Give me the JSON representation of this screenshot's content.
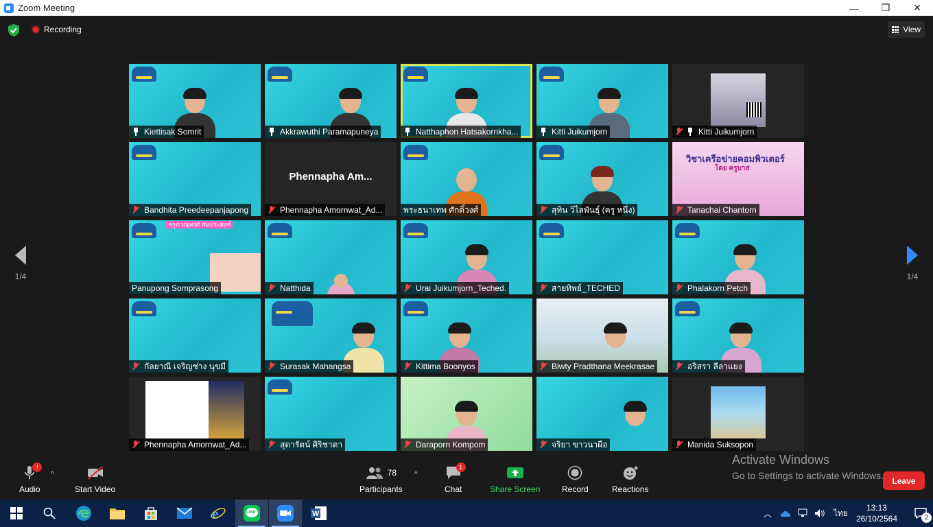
{
  "window": {
    "title": "Zoom Meeting",
    "controls": [
      "—",
      "❐",
      "✕"
    ]
  },
  "topbar": {
    "recording_label": "Recording",
    "view_label": "View"
  },
  "pager": {
    "left_text": "1/4",
    "right_text": "1/4"
  },
  "participants": [
    {
      "name": "Kiettisak Somrit",
      "status": "pin"
    },
    {
      "name": "Akkrawuthi Paramapuneya",
      "status": "pin"
    },
    {
      "name": "Natthaphon Hatsakornkha...",
      "status": "pin",
      "active": true
    },
    {
      "name": "Kitti Juikumjorn",
      "status": "pin"
    },
    {
      "name": "Kitti Juikumjorn",
      "status": "muted-pin"
    },
    {
      "name": "Bandhita Preedeepanjapong",
      "status": "muted"
    },
    {
      "name": "Phennapha Amornwat_Ad...",
      "status": "muted",
      "big_name": "Phennapha  Am..."
    },
    {
      "name": "พระธนาเทพ ศักดิ์วงศ์",
      "status": "none"
    },
    {
      "name": "สุทิน วิไลพันธุ์ (ครู หนึ่ง)",
      "status": "muted"
    },
    {
      "name": "Tanachai Chantorn",
      "status": "muted",
      "title_text": "วิชาเครือข่ายคอมพิวเตอร์",
      "sub_text": "โดย ครูบาส"
    },
    {
      "name": "Panupong Somprasong",
      "status": "none",
      "tag_text": "ครูภาณุพงศ์ สมประสงค์"
    },
    {
      "name": "Natthida",
      "status": "muted"
    },
    {
      "name": "Urai Juikumjorn_Teched.",
      "status": "muted"
    },
    {
      "name": "สายทิพย์_TECHED",
      "status": "muted"
    },
    {
      "name": "Phalakorn Petch",
      "status": "muted"
    },
    {
      "name": "กัลยาณี เจริญช่าง นุขมี",
      "status": "muted"
    },
    {
      "name": "Surasak Mahangsa",
      "status": "muted"
    },
    {
      "name": "Kittima Boonyos",
      "status": "muted"
    },
    {
      "name": "Biwty Pradthana Meekrasae",
      "status": "muted"
    },
    {
      "name": "อริสรา ลีลาแยง",
      "status": "muted"
    },
    {
      "name": "Phennapha Amornwat_Ad...",
      "status": "muted"
    },
    {
      "name": "สุดารัตน์ ศิริชาตา",
      "status": "muted"
    },
    {
      "name": "Daraporn Kompom",
      "status": "muted"
    },
    {
      "name": "จริยา ขาวนาผือ",
      "status": "muted"
    },
    {
      "name": "Manida Suksopon",
      "status": "muted"
    }
  ],
  "toolbar": {
    "audio_label": "Audio",
    "audio_badge": "!",
    "video_label": "Start Video",
    "participants_label": "Participants",
    "participants_count": "78",
    "chat_label": "Chat",
    "chat_badge": "1",
    "share_label": "Share Screen",
    "record_label": "Record",
    "reactions_label": "Reactions",
    "leave_label": "Leave"
  },
  "watermark": {
    "line1": "Activate Windows",
    "line2": "Go to Settings to activate Windows."
  },
  "taskbar": {
    "apps": [
      "start-icon",
      "search-icon",
      "edge-icon",
      "file-explorer-icon",
      "store-icon",
      "mail-icon",
      "ie-icon",
      "line-icon",
      "zoom-icon",
      "word-icon"
    ],
    "line_label": "LINE",
    "language": "ไทย",
    "time": "13:13",
    "date": "26/10/2564",
    "notification_count": "2"
  },
  "colors": {
    "accent_blue": "#2d8cff",
    "leave_red": "#e02828",
    "share_green": "#12b34b",
    "active_border": "#d7e45a"
  }
}
